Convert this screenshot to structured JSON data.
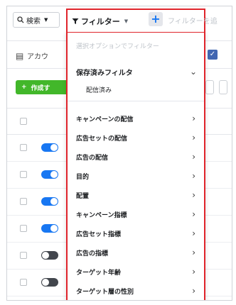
{
  "toolbar": {
    "search_label": "検索",
    "filter_label": "フィルター",
    "plus_label": "+",
    "filter_hint": "フィルターを追"
  },
  "account": {
    "label": "アカウ"
  },
  "create": {
    "label": "作成す",
    "plus": "+"
  },
  "dropdown": {
    "placeholder": "選択オプションでフィルター",
    "saved_filters": "保存済みフィルタ",
    "saved_sub": "配信済み",
    "items": [
      "キャンペーンの配信",
      "広告セットの配信",
      "広告の配信",
      "目的",
      "配置",
      "キャンペーン指標",
      "広告セット指標",
      "広告の指標",
      "ターゲット年齢",
      "ターゲット層の性別"
    ]
  },
  "rows": [
    {
      "toggle": "on"
    },
    {
      "toggle": "on"
    },
    {
      "toggle": "on"
    },
    {
      "toggle": "on"
    },
    {
      "toggle": "off"
    },
    {
      "toggle": "off"
    }
  ],
  "colors": {
    "highlight": "#e0242b",
    "accent": "#1877f2",
    "create": "#42b72a"
  }
}
